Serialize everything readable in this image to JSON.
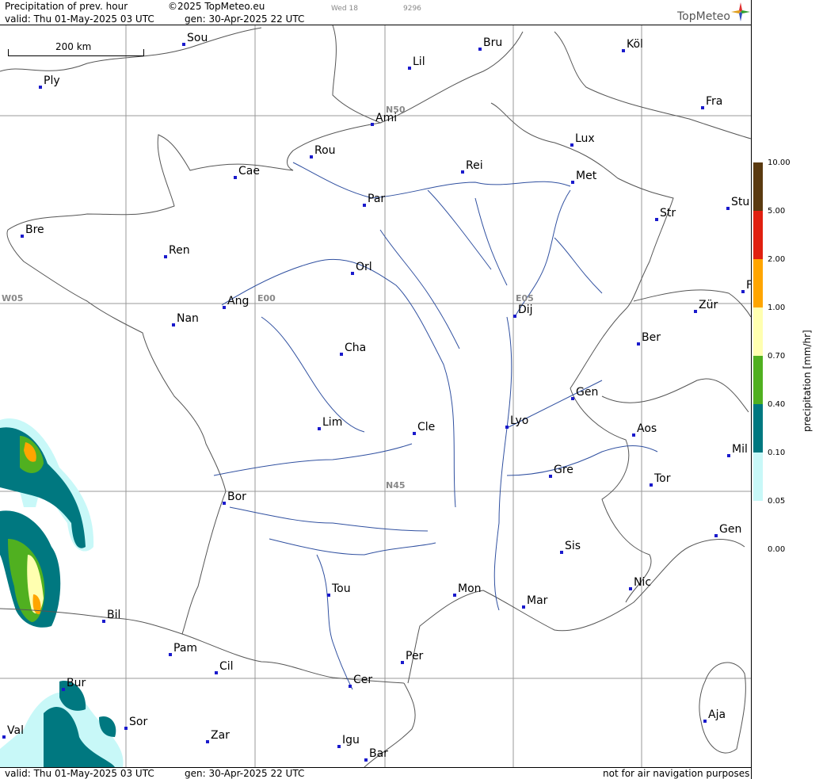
{
  "header": {
    "title": "Precipitation of prev. hour",
    "copyright": "©2025 TopMeteo.eu",
    "valid": "valid:  Thu  01-May-2025  03 UTC",
    "gen": "gen:  30-Apr-2025 22 UTC",
    "small1": "Wed 18",
    "small2": "9296",
    "brand": "TopMeteo"
  },
  "footer": {
    "valid": "valid:  Thu  01-May-2025  03 UTC",
    "gen": "gen:  30-Apr-2025 22 UTC",
    "note": "not for air navigation purposes"
  },
  "scale": {
    "label": "200 km"
  },
  "grid_labels": [
    "N50",
    "W05",
    "E00",
    "E05",
    "N45"
  ],
  "cities": [
    "Sou",
    "Bru",
    "Köl",
    "Lil",
    "Ply",
    "Ami",
    "Fra",
    "Lux",
    "Rou",
    "Cae",
    "Rei",
    "Met",
    "Par",
    "Stu",
    "Str",
    "Bre",
    "Ren",
    "Orl",
    "Ang",
    "Nan",
    "Dij",
    "Zür",
    "Ber",
    "Cha",
    "Gen",
    "Lim",
    "Cle",
    "Lyo",
    "Aos",
    "Mil",
    "Gre",
    "Tor",
    "Bor",
    "Sis",
    "Gen",
    "Tou",
    "Mon",
    "Mar",
    "Nic",
    "Bil",
    "Pam",
    "Cil",
    "Per",
    "Cer",
    "Bur",
    "Sor",
    "Val",
    "Zar",
    "Igu",
    "Bar",
    "Aja",
    "F"
  ],
  "legend": {
    "unit_label": "precipitation [mm/hr]",
    "ticks": [
      "10.00",
      "5.00",
      "2.00",
      "1.00",
      "0.70",
      "0.40",
      "0.10",
      "0.05",
      "0.00"
    ],
    "colors": [
      "#5a3a10",
      "#e02010",
      "#ffa500",
      "#ffffb0",
      "#50b020",
      "#007880",
      "#c8f8f8",
      "#ffffff"
    ]
  }
}
